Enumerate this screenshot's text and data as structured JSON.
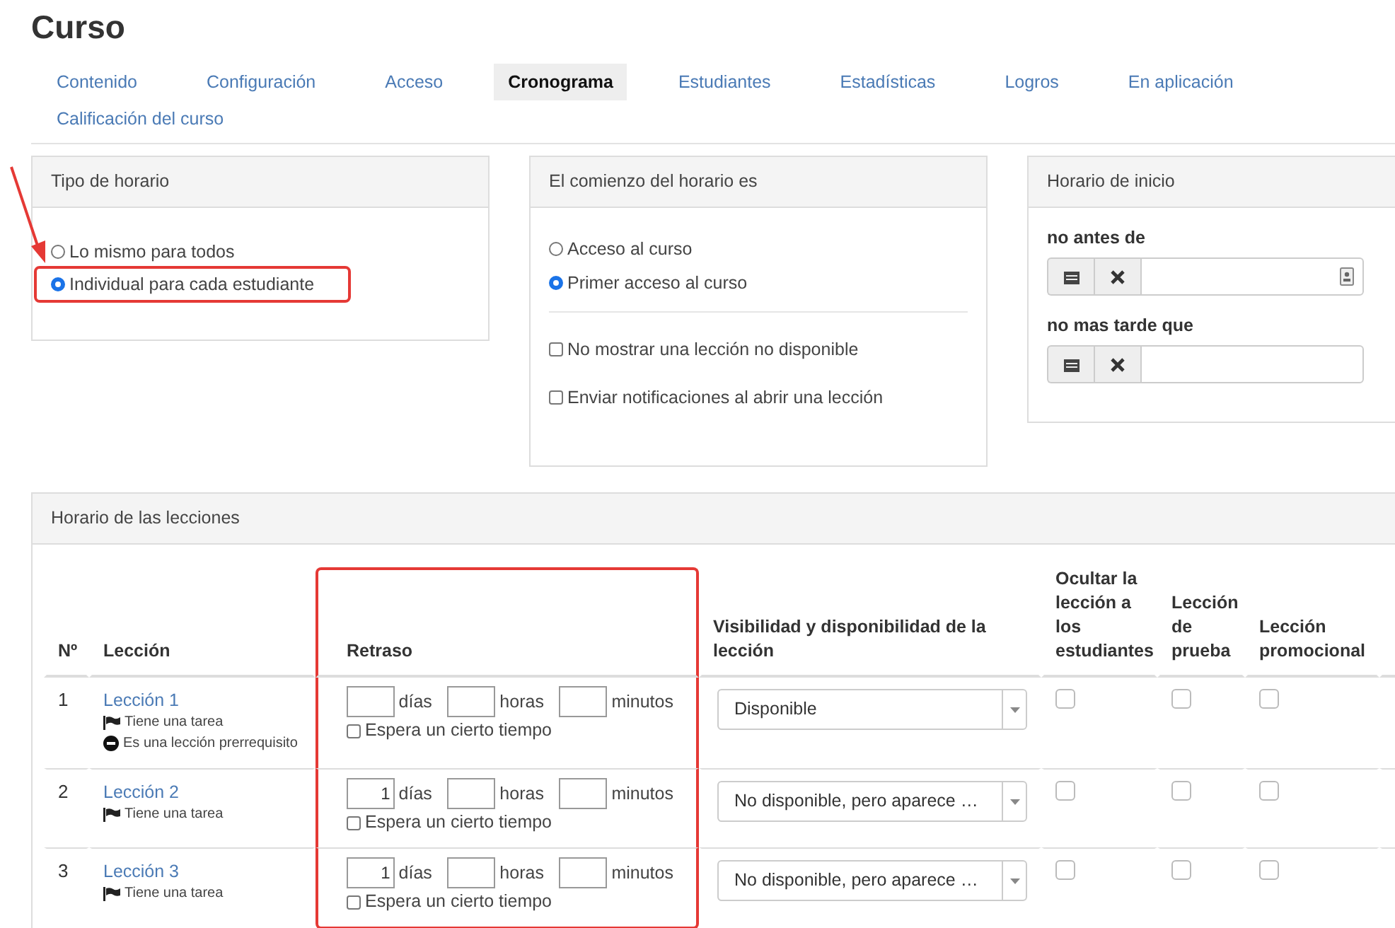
{
  "title": "Curso",
  "tabs": [
    {
      "label": "Contenido",
      "selected": false
    },
    {
      "label": "Configuración",
      "selected": false
    },
    {
      "label": "Acceso",
      "selected": false
    },
    {
      "label": "Cronograma",
      "selected": true
    },
    {
      "label": "Estudiantes",
      "selected": false
    },
    {
      "label": "Estadísticas",
      "selected": false
    },
    {
      "label": "Logros",
      "selected": false
    },
    {
      "label": "En aplicación",
      "selected": false
    },
    {
      "label": "Calificación del curso",
      "selected": false
    }
  ],
  "annotations": [
    {
      "kind": "arrow"
    }
  ],
  "schedule_type": {
    "title": "Tipo de horario",
    "options": [
      {
        "label": "Lo mismo para todos",
        "selected": false,
        "highlighted": false
      },
      {
        "label": "Individual para cada estudiante",
        "selected": true,
        "highlighted": true
      }
    ]
  },
  "schedule_start": {
    "title": "El comienzo del horario es",
    "options": [
      {
        "label": "Acceso al curso",
        "selected": false
      },
      {
        "label": "Primer acceso al curso",
        "selected": true
      }
    ],
    "checkboxes": [
      {
        "label": "No mostrar una lección no disponible",
        "checked": false
      },
      {
        "label": "Enviar notificaciones al abrir una lección",
        "checked": false
      }
    ]
  },
  "start_time": {
    "title": "Horario de inicio",
    "fields": [
      {
        "label": "no antes de",
        "picker_icon": true
      },
      {
        "label": "no mas tarde que",
        "picker_icon": false
      }
    ]
  },
  "lessons": {
    "title": "Horario de las lecciones",
    "columns": [
      {
        "label": "Nº",
        "highlighted": false
      },
      {
        "label": "Lección",
        "highlighted": false
      },
      {
        "label": "Retraso",
        "highlighted": true
      },
      {
        "label": "Visibilidad y disponibilidad de la lección",
        "highlighted": false
      },
      {
        "label": "Ocultar la lección a los estudiantes",
        "highlighted": false
      },
      {
        "label": "Lección de prueba",
        "highlighted": false
      },
      {
        "label": "Lección promocional",
        "highlighted": false
      }
    ],
    "rows": [
      {
        "number": "1",
        "lesson": "Lección 1",
        "notes": [
          {
            "kind": "task",
            "text": "Tiene una tarea"
          },
          {
            "kind": "prerequisite",
            "text": "Es una lección prerrequisito"
          }
        ],
        "delay": [
          {
            "unit": "días"
          },
          {
            "unit": "horas"
          },
          {
            "unit": "minutos"
          }
        ],
        "wait": {
          "label": "Espera un cierto tiempo",
          "checked": false
        },
        "visibility": "Disponible",
        "flags": [
          {
            "checked": false
          },
          {
            "checked": false
          },
          {
            "checked": false
          }
        ]
      },
      {
        "number": "2",
        "lesson": "Lección 2",
        "notes": [
          {
            "kind": "task",
            "text": "Tiene una tarea"
          }
        ],
        "delay": [
          {
            "value": "1",
            "unit": "días"
          },
          {
            "unit": "horas"
          },
          {
            "unit": "minutos"
          }
        ],
        "wait": {
          "label": "Espera un cierto tiempo",
          "checked": false
        },
        "visibility": "No disponible, pero aparece …",
        "flags": [
          {
            "checked": false
          },
          {
            "checked": false
          },
          {
            "checked": false
          }
        ]
      },
      {
        "number": "3",
        "lesson": "Lección 3",
        "notes": [
          {
            "kind": "task",
            "text": "Tiene una tarea"
          }
        ],
        "delay": [
          {
            "value": "1",
            "unit": "días"
          },
          {
            "unit": "horas"
          },
          {
            "unit": "minutos"
          }
        ],
        "wait": {
          "label": "Espera un cierto tiempo",
          "checked": false
        },
        "visibility": "No disponible, pero aparece …",
        "flags": [
          {
            "checked": false
          },
          {
            "checked": false
          },
          {
            "checked": false
          }
        ]
      }
    ]
  }
}
